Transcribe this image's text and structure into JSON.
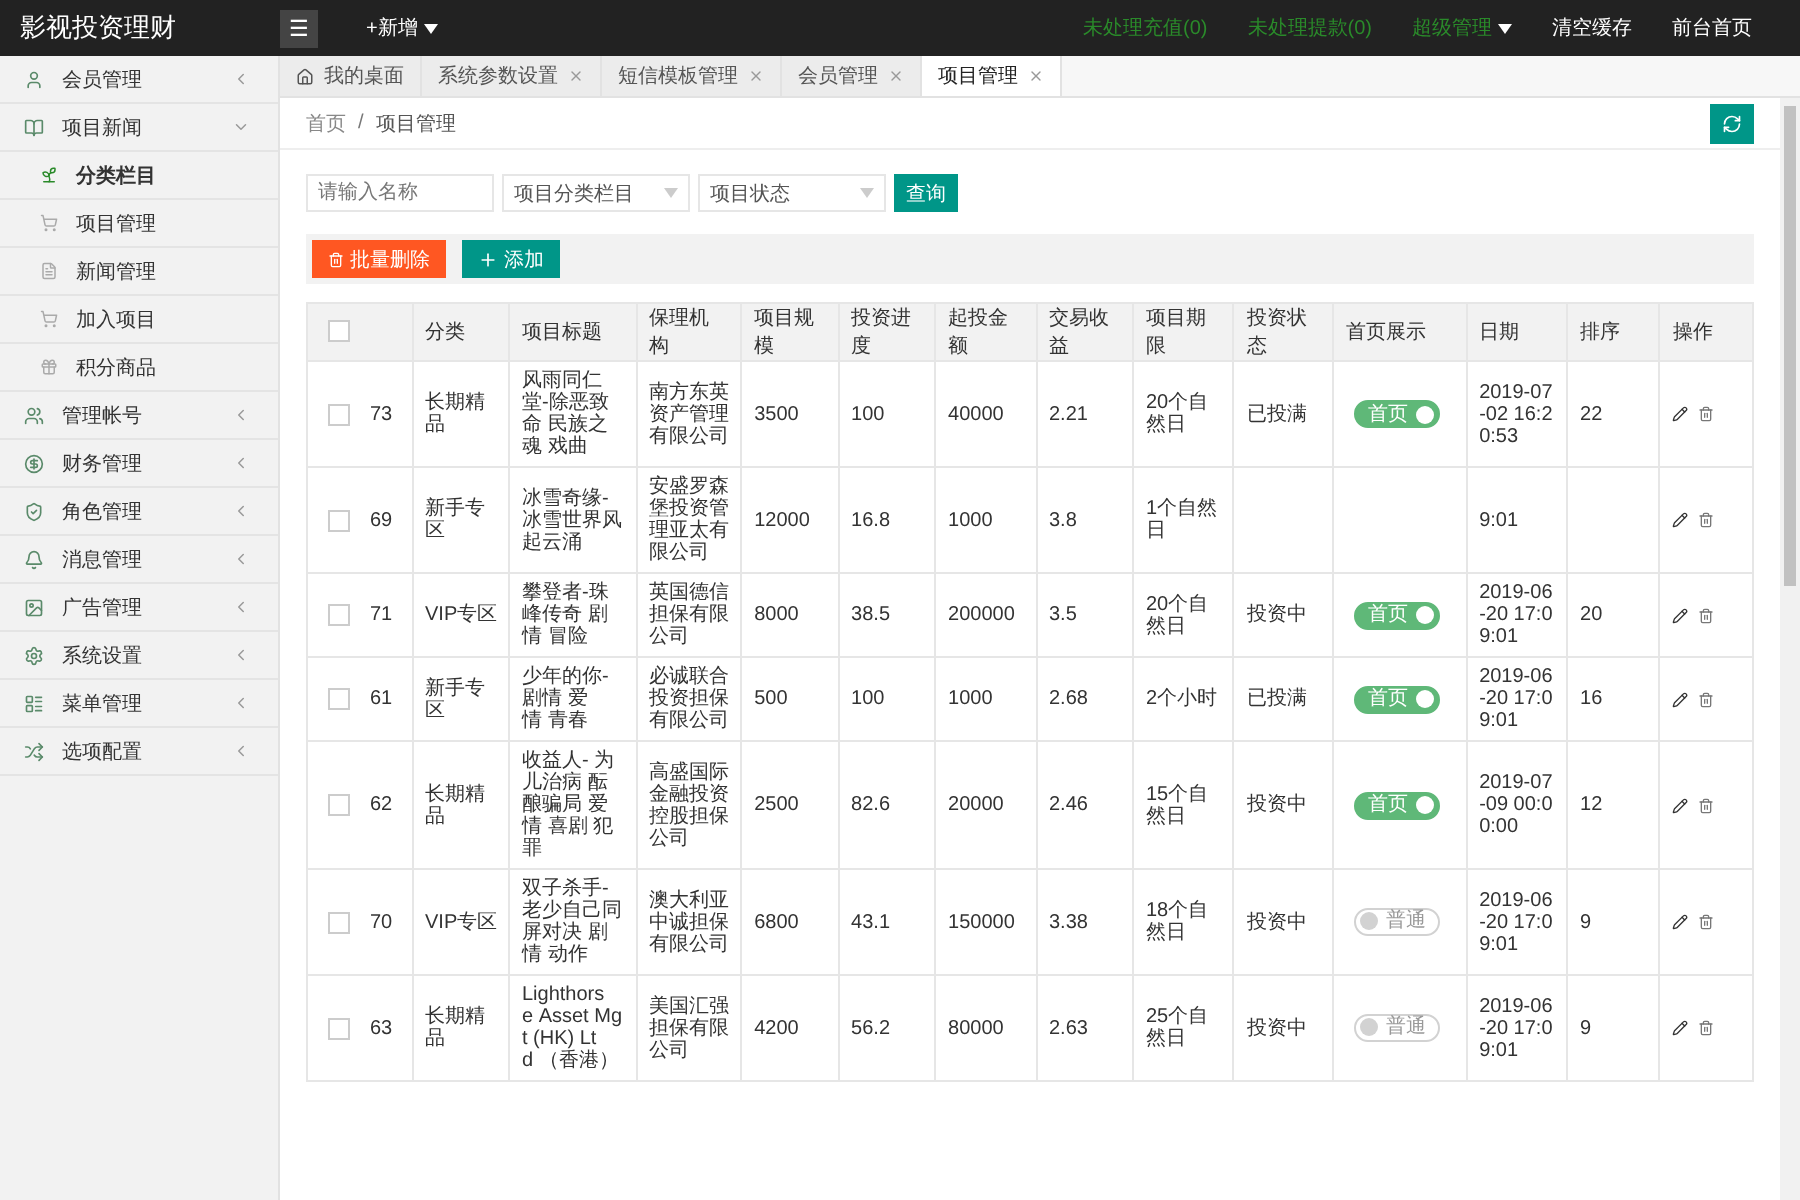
{
  "header": {
    "logo": "影视投资理财",
    "menu_icon": "☰",
    "new_button": "+新增",
    "links": [
      {
        "kind": "alert",
        "label": "未处理充值(0)"
      },
      {
        "kind": "alert",
        "label": "未处理提款(0)"
      },
      {
        "kind": "dropdown",
        "label": "超级管理"
      },
      {
        "kind": "plain",
        "label": "清空缓存"
      },
      {
        "kind": "plain",
        "label": "前台首页"
      }
    ]
  },
  "sidebar": {
    "items": [
      {
        "label": "会员管理",
        "expanded": false
      },
      {
        "label": "项目新闻",
        "expanded": true,
        "children": [
          {
            "label": "分类栏目",
            "selected": true
          },
          {
            "label": "项目管理",
            "selected": false
          },
          {
            "label": "新闻管理",
            "selected": false
          },
          {
            "label": "加入项目",
            "selected": false
          },
          {
            "label": "积分商品",
            "selected": false
          }
        ]
      },
      {
        "label": "管理帐号",
        "expanded": false
      },
      {
        "label": "财务管理",
        "expanded": false
      },
      {
        "label": "角色管理",
        "expanded": false
      },
      {
        "label": "消息管理",
        "expanded": false
      },
      {
        "label": "广告管理",
        "expanded": false
      },
      {
        "label": "系统设置",
        "expanded": false
      },
      {
        "label": "菜单管理",
        "expanded": false
      },
      {
        "label": "选项配置",
        "expanded": false
      }
    ]
  },
  "tabs": [
    {
      "label": "我的桌面",
      "selected": false,
      "closable": false
    },
    {
      "label": "系统参数设置",
      "selected": false,
      "closable": true
    },
    {
      "label": "短信模板管理",
      "selected": false,
      "closable": true
    },
    {
      "label": "会员管理",
      "selected": false,
      "closable": true
    },
    {
      "label": "项目管理",
      "selected": true,
      "closable": true
    }
  ],
  "breadcrumb": {
    "separator": "/",
    "items": [
      "首页",
      "项目管理"
    ]
  },
  "filters": {
    "name": {
      "placeholder": "请输入名称"
    },
    "selects": [
      "项目分类栏目",
      "项目状态"
    ],
    "search_button": "查询"
  },
  "actions": {
    "delete": "批量删除",
    "add": "添加"
  },
  "table": {
    "all_checked": false,
    "columns": [
      "分类",
      "项目标题",
      "保理机构",
      "项目规模",
      "投资进度",
      "起投金额",
      "交易收益",
      "项目期限",
      "投资状态",
      "首页展示",
      "日期",
      "排序",
      "操作"
    ],
    "rows": [
      {
        "checked": false,
        "id": "73",
        "category": "长期精品",
        "title": "风雨同仁堂-除恶致命 民族之魂 戏曲",
        "agency": "南方东英资产管理有限公司",
        "scale": "3500",
        "progress": "100",
        "min": "40000",
        "yield": "2.21",
        "term": "20个自然日",
        "status": "已投满",
        "home": {
          "on": true,
          "label": "首页"
        },
        "date": "2019-07-02 16:20:53",
        "sort": "22"
      },
      {
        "checked": false,
        "id": "69",
        "category": "新手专区",
        "title": "冰雪奇缘-冰雪世界风起云涌",
        "agency": "安盛罗森堡投资管理亚太有限公司",
        "scale": "12000",
        "progress": "16.8",
        "min": "1000",
        "yield": "3.8",
        "term": "1个自然日",
        "date": "9:01"
      },
      {
        "checked": false,
        "id": "71",
        "category": "VIP专区",
        "title": "攀登者-珠峰传奇 剧情 冒险",
        "agency": "英国德信担保有限公司",
        "scale": "8000",
        "progress": "38.5",
        "min": "200000",
        "yield": "3.5",
        "term": "20个自然日",
        "status": "投资中",
        "home": {
          "on": true,
          "label": "首页"
        },
        "date": "2019-06-20 17:09:01",
        "sort": "20"
      },
      {
        "checked": false,
        "id": "61",
        "category": "新手专区",
        "title": "少年的你-剧情 爱情 青春",
        "agency": "必诚联合投资担保有限公司",
        "scale": "500",
        "progress": "100",
        "min": "1000",
        "yield": "2.68",
        "term": "2个小时",
        "status": "已投满",
        "home": {
          "on": true,
          "label": "首页"
        },
        "date": "2019-06-20 17:09:01",
        "sort": "16"
      },
      {
        "checked": false,
        "id": "62",
        "category": "长期精品",
        "title": "收益人- 为儿治病 酝酿骗局 爱情 喜剧 犯罪",
        "agency": "高盛国际金融投资控股担保公司",
        "scale": "2500",
        "progress": "82.6",
        "min": "20000",
        "yield": "2.46",
        "term": "15个自然日",
        "status": "投资中",
        "home": {
          "on": true,
          "label": "首页"
        },
        "date": "2019-07-09 00:00:00",
        "sort": "12"
      },
      {
        "checked": false,
        "id": "70",
        "category": "VIP专区",
        "title": "双子杀手-老少自己同屏对决 剧情 动作",
        "agency": "澳大利亚中诚担保有限公司",
        "scale": "6800",
        "progress": "43.1",
        "min": "150000",
        "yield": "3.38",
        "term": "18个自然日",
        "status": "投资中",
        "home": {
          "on": false,
          "label": "普通"
        },
        "date": "2019-06-20 17:09:01",
        "sort": "9"
      },
      {
        "checked": false,
        "id": "63",
        "category": "长期精品",
        "title": "Lighthorse Asset Mgt (HK) Ltd （香港）",
        "agency": "美国汇强担保有限公司",
        "scale": "4200",
        "progress": "56.2",
        "min": "80000",
        "yield": "2.63",
        "term": "25个自然日",
        "status": "投资中",
        "home": {
          "on": false,
          "label": "普通"
        },
        "date": "2019-06-20 17:09:01",
        "sort": "9"
      }
    ]
  }
}
